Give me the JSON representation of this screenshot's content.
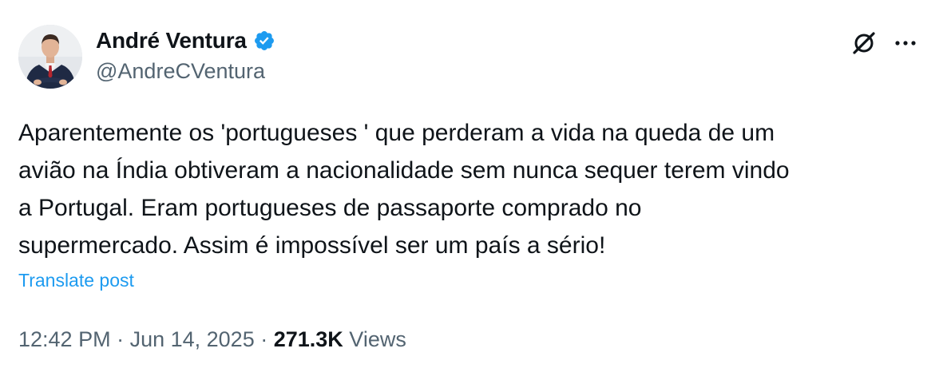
{
  "author": {
    "display_name": "André Ventura",
    "handle": "@AndreCVentura",
    "verified": true,
    "verified_badge_color": "#1d9bf0"
  },
  "actions": {
    "grok_icon": "grok-icon",
    "more_icon": "more-options-icon"
  },
  "tweet": {
    "text": "Aparentemente os 'portugueses ' que perderam a vida na queda de um\navião na Índia obtiveram a nacionalidade sem nunca sequer terem vindo\na Portugal. Eram portugueses de passaporte comprado no\nsupermercado. Assim é impossível ser um país a sério!",
    "translate_label": "Translate post"
  },
  "meta": {
    "time": "12:42 PM",
    "separator": " · ",
    "date": "Jun 14, 2025",
    "views_count": "271.3K",
    "views_label": " Views"
  },
  "colors": {
    "text_primary": "#0f1419",
    "text_secondary": "#536471",
    "link": "#1d9bf0"
  }
}
